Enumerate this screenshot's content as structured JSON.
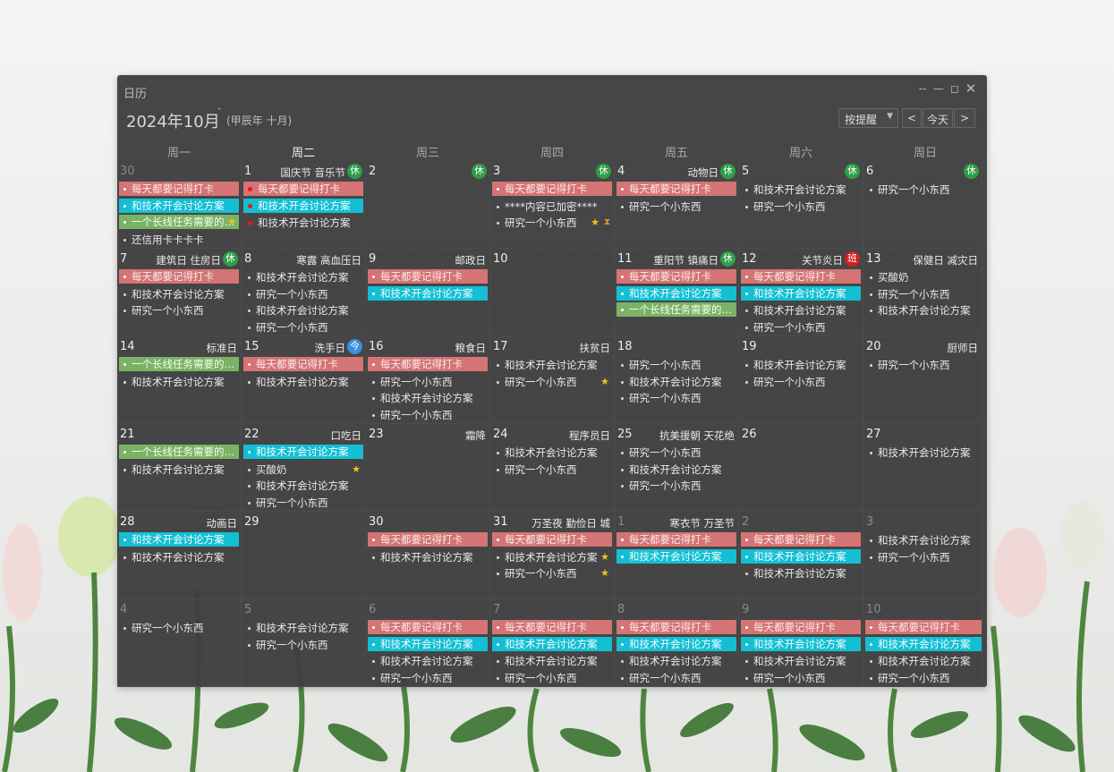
{
  "app_title": "日历",
  "window_controls": [
    "--",
    "—",
    "◻",
    "✕"
  ],
  "header": {
    "month_title": "2024年10月",
    "month_caret": "ˇ",
    "lunar_label": "(甲辰年 十月)",
    "remind_select": "按提醒",
    "prev": "<",
    "today": "今天",
    "next": ">"
  },
  "weekdays": [
    "周一",
    "周二",
    "周三",
    "周四",
    "周五",
    "周六",
    "周日"
  ],
  "weeks": [
    [
      {
        "day": "30",
        "other": true,
        "events": [
          {
            "t": "每天都要记得打卡",
            "s": "pink"
          },
          {
            "t": "和技术开会讨论方案",
            "s": "cyan"
          },
          {
            "t": "一个长线任务需要的…",
            "s": "green",
            "star": true
          },
          {
            "t": "还信用卡卡卡卡",
            "s": "plain"
          }
        ]
      },
      {
        "day": "1",
        "festival": "国庆节 音乐节",
        "badge": "休",
        "badgeType": "rest",
        "events": [
          {
            "t": "每天都要记得打卡",
            "s": "pink",
            "reddot": true
          },
          {
            "t": "和技术开会讨论方案",
            "s": "cyan",
            "reddot": true
          },
          {
            "t": "和技术开会讨论方案",
            "s": "plain",
            "reddot": true
          }
        ]
      },
      {
        "day": "2",
        "badge": "休",
        "badgeType": "rest",
        "events": []
      },
      {
        "day": "3",
        "badge": "休",
        "badgeType": "rest",
        "events": [
          {
            "t": "每天都要记得打卡",
            "s": "pink"
          },
          {
            "t": "****内容已加密****",
            "s": "plain"
          },
          {
            "t": "研究一个小东西",
            "s": "plain",
            "star": true,
            "hour": true
          }
        ]
      },
      {
        "day": "4",
        "festival": "动物日",
        "badge": "休",
        "badgeType": "rest",
        "events": [
          {
            "t": "每天都要记得打卡",
            "s": "pink"
          },
          {
            "t": "研究一个小东西",
            "s": "plain"
          }
        ]
      },
      {
        "day": "5",
        "badge": "休",
        "badgeType": "rest",
        "events": [
          {
            "t": "和技术开会讨论方案",
            "s": "plain"
          },
          {
            "t": "研究一个小东西",
            "s": "plain"
          }
        ]
      },
      {
        "day": "6",
        "badge": "休",
        "badgeType": "rest",
        "events": [
          {
            "t": "研究一个小东西",
            "s": "plain"
          }
        ]
      }
    ],
    [
      {
        "day": "7",
        "festival": "建筑日 住房日",
        "badge": "休",
        "badgeType": "rest",
        "events": [
          {
            "t": "每天都要记得打卡",
            "s": "pink"
          },
          {
            "t": "和技术开会讨论方案",
            "s": "plain"
          },
          {
            "t": "研究一个小东西",
            "s": "plain"
          }
        ]
      },
      {
        "day": "8",
        "festival": "寒露 高血压日",
        "events": [
          {
            "t": "和技术开会讨论方案",
            "s": "plain"
          },
          {
            "t": "研究一个小东西",
            "s": "plain"
          },
          {
            "t": "和技术开会讨论方案",
            "s": "plain"
          },
          {
            "t": "研究一个小东西",
            "s": "plain"
          }
        ]
      },
      {
        "day": "9",
        "festival": "邮政日",
        "events": [
          {
            "t": "每天都要记得打卡",
            "s": "pink"
          },
          {
            "t": "和技术开会讨论方案",
            "s": "cyan"
          }
        ]
      },
      {
        "day": "10",
        "events": []
      },
      {
        "day": "11",
        "festival": "重阳节 镇痛日",
        "badge": "休",
        "badgeType": "rest",
        "events": [
          {
            "t": "每天都要记得打卡",
            "s": "pink"
          },
          {
            "t": "和技术开会讨论方案",
            "s": "cyan"
          },
          {
            "t": "一个长线任务需要的…",
            "s": "green"
          }
        ]
      },
      {
        "day": "12",
        "festival": "关节炎日",
        "badge": "班",
        "badgeType": "work",
        "events": [
          {
            "t": "每天都要记得打卡",
            "s": "pink"
          },
          {
            "t": "和技术开会讨论方案",
            "s": "cyan"
          },
          {
            "t": "和技术开会讨论方案",
            "s": "plain"
          },
          {
            "t": "研究一个小东西",
            "s": "plain"
          }
        ]
      },
      {
        "day": "13",
        "festival": "保健日 减灾日",
        "events": [
          {
            "t": "买酸奶",
            "s": "plain"
          },
          {
            "t": "研究一个小东西",
            "s": "plain"
          },
          {
            "t": "和技术开会讨论方案",
            "s": "plain"
          }
        ]
      }
    ],
    [
      {
        "day": "14",
        "festival": "标准日",
        "events": [
          {
            "t": "一个长线任务需要的…",
            "s": "green"
          },
          {
            "t": "和技术开会讨论方案",
            "s": "plain"
          }
        ]
      },
      {
        "day": "15",
        "festival": "洗手日",
        "badge": "今",
        "badgeType": "today",
        "events": [
          {
            "t": "每天都要记得打卡",
            "s": "pink"
          },
          {
            "t": "和技术开会讨论方案",
            "s": "plain"
          }
        ]
      },
      {
        "day": "16",
        "festival": "粮食日",
        "events": [
          {
            "t": "每天都要记得打卡",
            "s": "pink"
          },
          {
            "t": "研究一个小东西",
            "s": "plain"
          },
          {
            "t": "和技术开会讨论方案",
            "s": "plain"
          },
          {
            "t": "研究一个小东西",
            "s": "plain"
          }
        ]
      },
      {
        "day": "17",
        "festival": "扶贫日",
        "events": [
          {
            "t": "和技术开会讨论方案",
            "s": "plain"
          },
          {
            "t": "研究一个小东西",
            "s": "plain",
            "star": true
          }
        ]
      },
      {
        "day": "18",
        "events": [
          {
            "t": "研究一个小东西",
            "s": "plain"
          },
          {
            "t": "和技术开会讨论方案",
            "s": "plain"
          },
          {
            "t": "研究一个小东西",
            "s": "plain"
          }
        ]
      },
      {
        "day": "19",
        "events": [
          {
            "t": "和技术开会讨论方案",
            "s": "plain"
          },
          {
            "t": "研究一个小东西",
            "s": "plain"
          }
        ]
      },
      {
        "day": "20",
        "festival": "厨师日",
        "events": [
          {
            "t": "研究一个小东西",
            "s": "plain"
          }
        ]
      }
    ],
    [
      {
        "day": "21",
        "events": [
          {
            "t": "一个长线任务需要的…",
            "s": "green"
          },
          {
            "t": "和技术开会讨论方案",
            "s": "plain"
          }
        ]
      },
      {
        "day": "22",
        "festival": "口吃日",
        "events": [
          {
            "t": "和技术开会讨论方案",
            "s": "cyan"
          },
          {
            "t": "买酸奶",
            "s": "plain",
            "star": true
          },
          {
            "t": "和技术开会讨论方案",
            "s": "plain"
          },
          {
            "t": "研究一个小东西",
            "s": "plain"
          }
        ]
      },
      {
        "day": "23",
        "festival": "霜降",
        "events": []
      },
      {
        "day": "24",
        "festival": "程序员日",
        "events": [
          {
            "t": "和技术开会讨论方案",
            "s": "plain"
          },
          {
            "t": "研究一个小东西",
            "s": "plain"
          }
        ]
      },
      {
        "day": "25",
        "festival": "抗美援朝 天花绝",
        "events": [
          {
            "t": "研究一个小东西",
            "s": "plain"
          },
          {
            "t": "和技术开会讨论方案",
            "s": "plain"
          },
          {
            "t": "研究一个小东西",
            "s": "plain"
          }
        ]
      },
      {
        "day": "26",
        "events": []
      },
      {
        "day": "27",
        "events": [
          {
            "t": "和技术开会讨论方案",
            "s": "plain"
          }
        ]
      }
    ],
    [
      {
        "day": "28",
        "festival": "动画日",
        "events": [
          {
            "t": "和技术开会讨论方案",
            "s": "cyan"
          },
          {
            "t": "和技术开会讨论方案",
            "s": "plain"
          }
        ]
      },
      {
        "day": "29",
        "events": []
      },
      {
        "day": "30",
        "events": [
          {
            "t": "每天都要记得打卡",
            "s": "pink"
          },
          {
            "t": "和技术开会讨论方案",
            "s": "plain"
          }
        ]
      },
      {
        "day": "31",
        "festival": "万圣夜 勤俭日 城",
        "events": [
          {
            "t": "每天都要记得打卡",
            "s": "pink"
          },
          {
            "t": "和技术开会讨论方案",
            "s": "plain",
            "star": true
          },
          {
            "t": "研究一个小东西",
            "s": "plain",
            "star": true
          }
        ]
      },
      {
        "day": "1",
        "other": true,
        "festival": "寒衣节 万圣节",
        "events": [
          {
            "t": "每天都要记得打卡",
            "s": "pink"
          },
          {
            "t": "和技术开会讨论方案",
            "s": "cyan"
          }
        ]
      },
      {
        "day": "2",
        "other": true,
        "events": [
          {
            "t": "每天都要记得打卡",
            "s": "pink"
          },
          {
            "t": "和技术开会讨论方案",
            "s": "cyan"
          },
          {
            "t": "和技术开会讨论方案",
            "s": "plain"
          }
        ]
      },
      {
        "day": "3",
        "other": true,
        "events": [
          {
            "t": "和技术开会讨论方案",
            "s": "plain"
          },
          {
            "t": "研究一个小东西",
            "s": "plain"
          }
        ]
      }
    ],
    [
      {
        "day": "4",
        "other": true,
        "events": [
          {
            "t": "研究一个小东西",
            "s": "plain"
          }
        ]
      },
      {
        "day": "5",
        "other": true,
        "events": [
          {
            "t": "和技术开会讨论方案",
            "s": "plain"
          },
          {
            "t": "研究一个小东西",
            "s": "plain"
          }
        ]
      },
      {
        "day": "6",
        "other": true,
        "events": [
          {
            "t": "每天都要记得打卡",
            "s": "pink"
          },
          {
            "t": "和技术开会讨论方案",
            "s": "cyan"
          },
          {
            "t": "和技术开会讨论方案",
            "s": "plain"
          },
          {
            "t": "研究一个小东西",
            "s": "plain"
          }
        ]
      },
      {
        "day": "7",
        "other": true,
        "events": [
          {
            "t": "每天都要记得打卡",
            "s": "pink"
          },
          {
            "t": "和技术开会讨论方案",
            "s": "cyan"
          },
          {
            "t": "和技术开会讨论方案",
            "s": "plain"
          },
          {
            "t": "研究一个小东西",
            "s": "plain"
          }
        ]
      },
      {
        "day": "8",
        "other": true,
        "events": [
          {
            "t": "每天都要记得打卡",
            "s": "pink"
          },
          {
            "t": "和技术开会讨论方案",
            "s": "cyan"
          },
          {
            "t": "和技术开会讨论方案",
            "s": "plain"
          },
          {
            "t": "研究一个小东西",
            "s": "plain"
          }
        ]
      },
      {
        "day": "9",
        "other": true,
        "events": [
          {
            "t": "每天都要记得打卡",
            "s": "pink"
          },
          {
            "t": "和技术开会讨论方案",
            "s": "cyan"
          },
          {
            "t": "和技术开会讨论方案",
            "s": "plain"
          },
          {
            "t": "研究一个小东西",
            "s": "plain"
          }
        ]
      },
      {
        "day": "10",
        "other": true,
        "events": [
          {
            "t": "每天都要记得打卡",
            "s": "pink"
          },
          {
            "t": "和技术开会讨论方案",
            "s": "cyan"
          },
          {
            "t": "和技术开会讨论方案",
            "s": "plain"
          },
          {
            "t": "研究一个小东西",
            "s": "plain"
          }
        ]
      }
    ]
  ],
  "colors": {
    "pink": "#d47474",
    "cyan": "#14bfd3",
    "green": "#7bb265",
    "rest_badge": "#2e9e48",
    "work_badge": "#d42020",
    "today_badge": "#3a8fe0",
    "star": "#f2c21b"
  },
  "icons": {
    "star": "★",
    "hourglass": "⧗"
  }
}
